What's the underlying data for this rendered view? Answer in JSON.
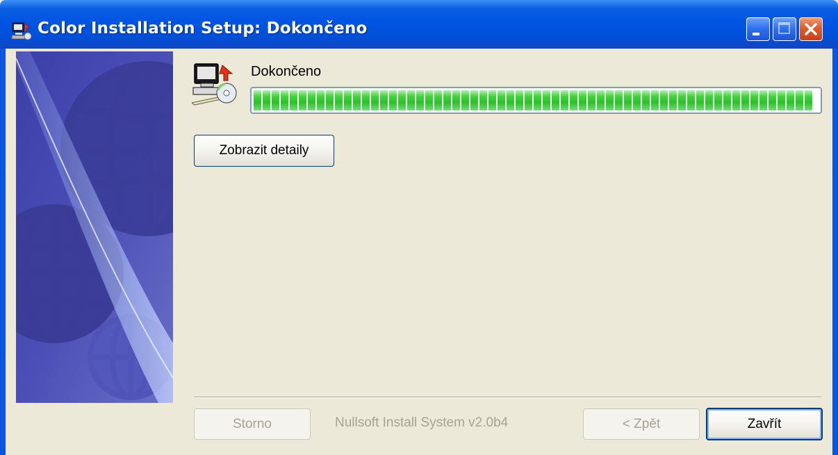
{
  "window": {
    "title": "Color Installation Setup: Dokončeno",
    "controls": [
      "minimize-icon",
      "maximize-icon",
      "close-icon"
    ]
  },
  "header": {
    "status_label": "Dokončeno",
    "progress_fraction": 1.0,
    "icon": "computer-install-icon"
  },
  "main": {
    "details_button_label": "Zobrazit detaily"
  },
  "footer": {
    "cancel_label": "Storno",
    "branding_text": "Nullsoft Install System v2.0b4",
    "back_label": "< Zpět",
    "close_label": "Zavřít"
  },
  "colors": {
    "titlebar": "#0054e3",
    "dialog_bg": "#ece9d8",
    "progress_green": "#2bc229",
    "disabled_text": "#a5a394"
  }
}
